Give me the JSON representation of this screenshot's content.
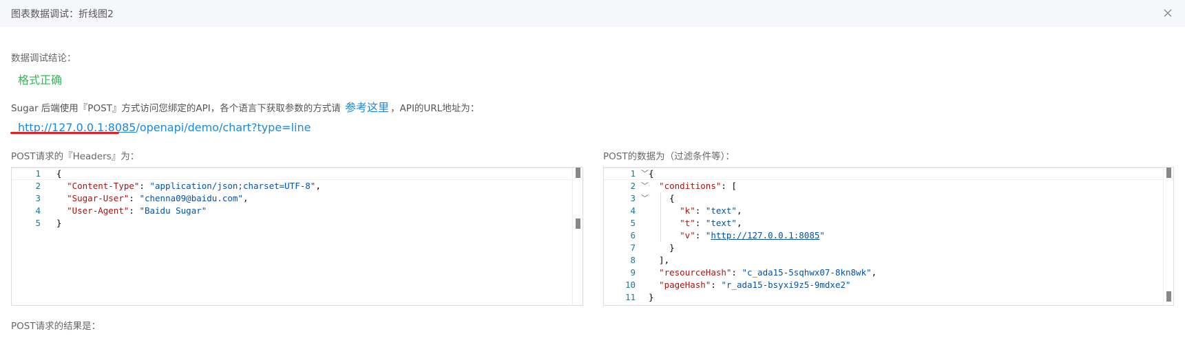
{
  "dialog": {
    "title": "图表数据调试：折线图2",
    "close_icon": "close-icon"
  },
  "conclusion": {
    "label": "数据调试结论：",
    "status": "格式正确",
    "status_color": "#35b559"
  },
  "description": {
    "before": "Sugar 后端使用『POST』方式访问您绑定的API，各个语言下获取参数的方式请",
    "link": "参考这里",
    "after": "，API的URL地址为：",
    "link_color": "#1a88e0"
  },
  "api_url": {
    "host": "http://127.0.0.1:8085",
    "path": "/openapi/demo/chart?type=line"
  },
  "headers_panel": {
    "label": "POST请求的『Headers』为：",
    "lines": [
      {
        "n": "1",
        "parts": [
          {
            "t": "p",
            "v": "{"
          }
        ]
      },
      {
        "n": "2",
        "parts": [
          {
            "t": "p",
            "v": "  "
          },
          {
            "t": "k",
            "v": "\"Content-Type\""
          },
          {
            "t": "p",
            "v": ": "
          },
          {
            "t": "s",
            "v": "\"application/json;charset=UTF-8\""
          },
          {
            "t": "p",
            "v": ","
          }
        ]
      },
      {
        "n": "3",
        "parts": [
          {
            "t": "p",
            "v": "  "
          },
          {
            "t": "k",
            "v": "\"Sugar-User\""
          },
          {
            "t": "p",
            "v": ": "
          },
          {
            "t": "s",
            "v": "\"chenna09@baidu.com\""
          },
          {
            "t": "p",
            "v": ","
          }
        ]
      },
      {
        "n": "4",
        "parts": [
          {
            "t": "p",
            "v": "  "
          },
          {
            "t": "k",
            "v": "\"User-Agent\""
          },
          {
            "t": "p",
            "v": ": "
          },
          {
            "t": "s",
            "v": "\"Baidu Sugar\""
          }
        ]
      },
      {
        "n": "5",
        "parts": [
          {
            "t": "p",
            "v": "}"
          }
        ]
      }
    ]
  },
  "body_panel": {
    "label": "POST的数据为（过滤条件等）：",
    "lines": [
      {
        "n": "1",
        "fold": true,
        "parts": [
          {
            "t": "p",
            "v": "{"
          }
        ]
      },
      {
        "n": "2",
        "fold": true,
        "parts": [
          {
            "t": "p",
            "v": "  "
          },
          {
            "t": "k",
            "v": "\"conditions\""
          },
          {
            "t": "p",
            "v": ": ["
          }
        ]
      },
      {
        "n": "3",
        "fold": true,
        "parts": [
          {
            "t": "p",
            "v": "    {"
          }
        ]
      },
      {
        "n": "4",
        "parts": [
          {
            "t": "p",
            "v": "      "
          },
          {
            "t": "k",
            "v": "\"k\""
          },
          {
            "t": "p",
            "v": ": "
          },
          {
            "t": "s",
            "v": "\"text\""
          },
          {
            "t": "p",
            "v": ","
          }
        ]
      },
      {
        "n": "5",
        "parts": [
          {
            "t": "p",
            "v": "      "
          },
          {
            "t": "k",
            "v": "\"t\""
          },
          {
            "t": "p",
            "v": ": "
          },
          {
            "t": "s",
            "v": "\"text\""
          },
          {
            "t": "p",
            "v": ","
          }
        ]
      },
      {
        "n": "6",
        "parts": [
          {
            "t": "p",
            "v": "      "
          },
          {
            "t": "k",
            "v": "\"v\""
          },
          {
            "t": "p",
            "v": ": "
          },
          {
            "t": "s",
            "v": "\""
          },
          {
            "t": "u",
            "v": "http://127.0.0.1:8085"
          },
          {
            "t": "s",
            "v": "\""
          }
        ]
      },
      {
        "n": "7",
        "parts": [
          {
            "t": "p",
            "v": "    }"
          }
        ]
      },
      {
        "n": "8",
        "parts": [
          {
            "t": "p",
            "v": "  ],"
          }
        ]
      },
      {
        "n": "9",
        "parts": [
          {
            "t": "p",
            "v": "  "
          },
          {
            "t": "k",
            "v": "\"resourceHash\""
          },
          {
            "t": "p",
            "v": ": "
          },
          {
            "t": "s",
            "v": "\"c_ada15-5sqhwx07-8kn8wk\""
          },
          {
            "t": "p",
            "v": ","
          }
        ]
      },
      {
        "n": "10",
        "parts": [
          {
            "t": "p",
            "v": "  "
          },
          {
            "t": "k",
            "v": "\"pageHash\""
          },
          {
            "t": "p",
            "v": ": "
          },
          {
            "t": "s",
            "v": "\"r_ada15-bsyxi9z5-9mdxe2\""
          }
        ]
      },
      {
        "n": "11",
        "parts": [
          {
            "t": "p",
            "v": "}"
          }
        ]
      }
    ]
  },
  "result": {
    "label": "POST请求的结果是："
  }
}
